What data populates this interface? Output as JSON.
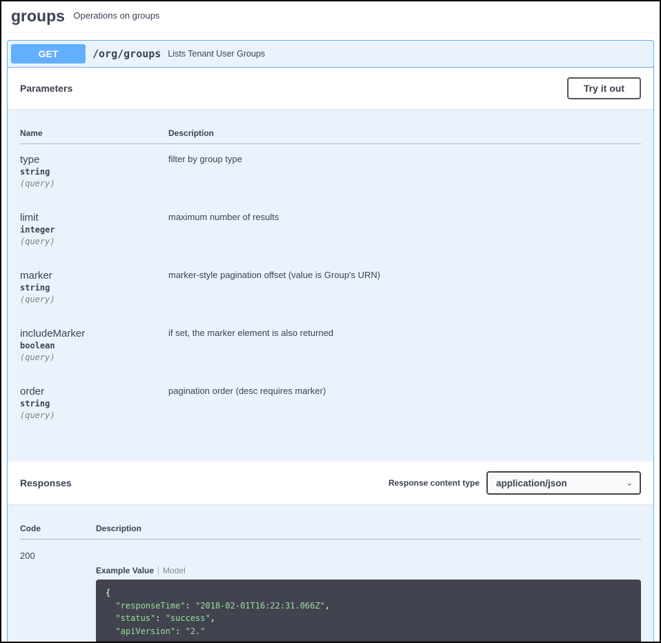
{
  "tag": {
    "name": "groups",
    "description": "Operations on groups"
  },
  "operation": {
    "method": "GET",
    "path": "/org/groups",
    "summary": "Lists Tenant User Groups"
  },
  "labels": {
    "parameters": "Parameters",
    "try_it_out": "Try it out",
    "col_name": "Name",
    "col_desc": "Description",
    "responses": "Responses",
    "content_type": "Response content type",
    "col_code": "Code",
    "col_rdesc": "Description",
    "example_value": "Example Value",
    "model": "Model"
  },
  "content_type_selected": "application/json",
  "parameters": [
    {
      "name": "type",
      "type": "string",
      "in": "(query)",
      "description": "filter by group type"
    },
    {
      "name": "limit",
      "type": "integer",
      "in": "(query)",
      "description": "maximum number of results"
    },
    {
      "name": "marker",
      "type": "string",
      "in": "(query)",
      "description": "marker-style pagination offset (value is Group's URN)"
    },
    {
      "name": "includeMarker",
      "type": "boolean",
      "in": "(query)",
      "description": "if set, the marker element is also returned"
    },
    {
      "name": "order",
      "type": "string",
      "in": "(query)",
      "description": "pagination order (desc requires marker)"
    }
  ],
  "responses": [
    {
      "code": "200",
      "example": {
        "responseTime": "2018-02-01T16:22:31.066Z",
        "status": "success",
        "apiVersion": "2."
      }
    }
  ]
}
